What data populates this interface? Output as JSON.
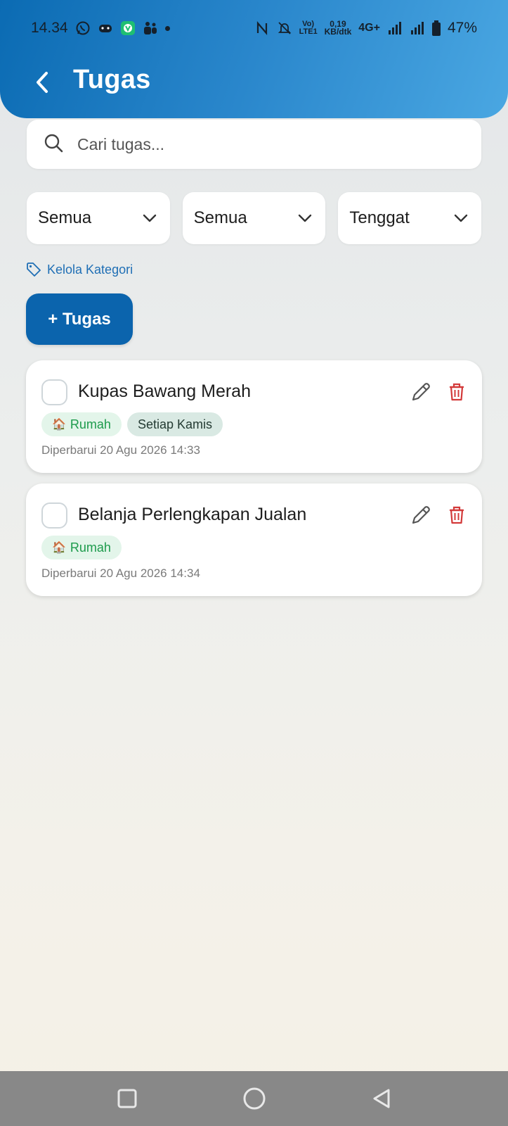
{
  "status_bar": {
    "time": "14.34",
    "lte_label": "Vo) LTE1",
    "speed_value": "0,19",
    "speed_unit": "KB/dtk",
    "network": "4G+",
    "battery": "47%"
  },
  "header": {
    "title": "Tugas"
  },
  "search": {
    "placeholder": "Cari tugas..."
  },
  "filters": [
    {
      "label": "Semua"
    },
    {
      "label": "Semua"
    },
    {
      "label": "Tenggat"
    }
  ],
  "manage_categories": {
    "label": "Kelola Kategori"
  },
  "add_button": {
    "label": "+ Tugas"
  },
  "tasks": [
    {
      "title": "Kupas Bawang Merah",
      "category": "Rumah",
      "category_emoji": "🏠",
      "recurrence": "Setiap Kamis",
      "updated": "Diperbarui 20 Agu 2026 14:33"
    },
    {
      "title": "Belanja Perlengkapan Jualan",
      "category": "Rumah",
      "category_emoji": "🏠",
      "updated": "Diperbarui 20 Agu 2026 14:34"
    }
  ],
  "colors": {
    "header_start": "#0b6bb3",
    "header_end": "#4aa7e2",
    "primary": "#0b64ad",
    "delete": "#d33a3a",
    "category_text": "#1d9b4c"
  }
}
